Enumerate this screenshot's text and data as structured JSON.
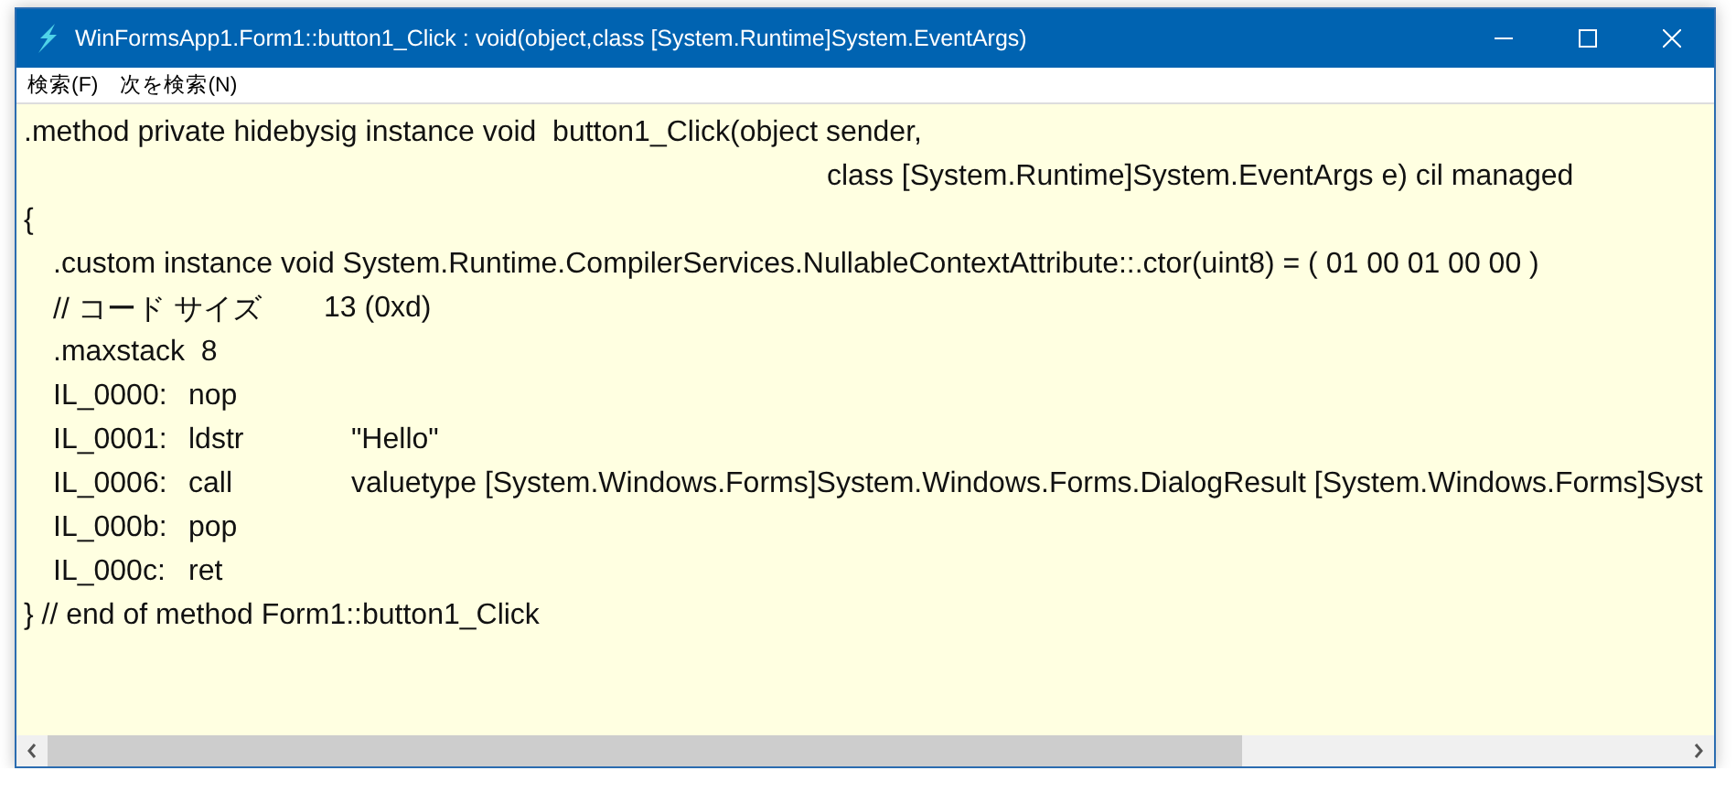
{
  "window": {
    "title": "WinFormsApp1.Form1::button1_Click : void(object,class [System.Runtime]System.EventArgs)"
  },
  "menu": [
    {
      "label": "検索(F)"
    },
    {
      "label": "次を検索(N)"
    }
  ],
  "code_lines": [
    {
      "kind": "text",
      "text": ".method private hidebysig instance void  button1_Click(object sender,"
    },
    {
      "kind": "continuation",
      "text": "class [System.Runtime]System.EventArgs e) cil managed"
    },
    {
      "kind": "text",
      "text": "{"
    },
    {
      "kind": "body",
      "text": ".custom instance void System.Runtime.CompilerServices.NullableContextAttribute::.ctor(uint8) = ( 01 00 01 00 00 )"
    },
    {
      "kind": "comment",
      "text": "// コード サイズ",
      "value": "13 (0xd)"
    },
    {
      "kind": "body",
      "text": ".maxstack  8"
    },
    {
      "kind": "instruction",
      "label": "IL_0000:",
      "opcode": "nop"
    },
    {
      "kind": "instruction",
      "label": "IL_0001:",
      "opcode": "ldstr",
      "operand": "\"Hello\""
    },
    {
      "kind": "instruction",
      "label": "IL_0006:",
      "opcode": "call",
      "operand": "valuetype [System.Windows.Forms]System.Windows.Forms.DialogResult [System.Windows.Forms]Syst"
    },
    {
      "kind": "instruction",
      "label": "IL_000b:",
      "opcode": "pop"
    },
    {
      "kind": "instruction",
      "label": "IL_000c:",
      "opcode": "ret"
    },
    {
      "kind": "text",
      "text": "} // end of method Form1::button1_Click"
    }
  ]
}
